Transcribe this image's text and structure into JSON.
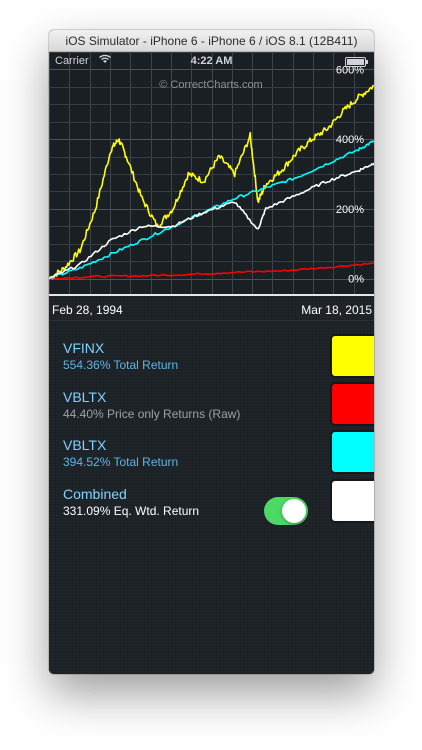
{
  "window": {
    "title": "iOS Simulator - iPhone 6 - iPhone 6 / iOS 8.1 (12B411)"
  },
  "status_bar": {
    "carrier": "Carrier",
    "wifi_icon": "wifi-icon",
    "time": "4:22 AM",
    "battery_icon": "battery-icon"
  },
  "chart": {
    "watermark": "© CorrectCharts.com",
    "start_date": "Feb 28, 1994",
    "end_date": "Mar 18, 2015"
  },
  "chart_data": {
    "type": "line",
    "x": [
      "Feb 28, 1994",
      "Mar 18, 2015"
    ],
    "yticks": [
      "0%",
      "200%",
      "400%",
      "600%"
    ],
    "ylim": [
      -50,
      650
    ],
    "grid": true,
    "series": [
      {
        "name": "VFINX",
        "color": "#ffff00",
        "values": [
          [
            0,
            0
          ],
          [
            1,
            30
          ],
          [
            2,
            80
          ],
          [
            3,
            200
          ],
          [
            4,
            370
          ],
          [
            4.5,
            400
          ],
          [
            5,
            350
          ],
          [
            6,
            230
          ],
          [
            7,
            150
          ],
          [
            8,
            200
          ],
          [
            9,
            300
          ],
          [
            10,
            280
          ],
          [
            11,
            350
          ],
          [
            12,
            300
          ],
          [
            13,
            410
          ],
          [
            13.5,
            220
          ],
          [
            14,
            270
          ],
          [
            15,
            310
          ],
          [
            16,
            360
          ],
          [
            17,
            400
          ],
          [
            18,
            430
          ],
          [
            19,
            480
          ],
          [
            20,
            520
          ],
          [
            21,
            554
          ]
        ]
      },
      {
        "name": "VBLTX",
        "color": "#ff0000",
        "values": [
          [
            0,
            0
          ],
          [
            3,
            6
          ],
          [
            6,
            8
          ],
          [
            9,
            12
          ],
          [
            12,
            18
          ],
          [
            15,
            22
          ],
          [
            18,
            32
          ],
          [
            21,
            44
          ]
        ]
      },
      {
        "name": "VBLTX",
        "color": "#00ffff",
        "values": [
          [
            0,
            0
          ],
          [
            2,
            30
          ],
          [
            4,
            70
          ],
          [
            6,
            110
          ],
          [
            8,
            150
          ],
          [
            10,
            190
          ],
          [
            12,
            230
          ],
          [
            14,
            260
          ],
          [
            16,
            290
          ],
          [
            18,
            330
          ],
          [
            20,
            370
          ],
          [
            21,
            395
          ]
        ]
      },
      {
        "name": "Combined",
        "color": "#ffffff",
        "values": [
          [
            0,
            0
          ],
          [
            2,
            40
          ],
          [
            4,
            110
          ],
          [
            6,
            150
          ],
          [
            8,
            150
          ],
          [
            10,
            190
          ],
          [
            12,
            220
          ],
          [
            13.5,
            140
          ],
          [
            14,
            200
          ],
          [
            16,
            240
          ],
          [
            18,
            280
          ],
          [
            20,
            310
          ],
          [
            21,
            331
          ]
        ]
      }
    ]
  },
  "legend": [
    {
      "name": "VFINX",
      "desc": "554.36% Total Return",
      "color": "#ffff00"
    },
    {
      "name": "VBLTX",
      "desc": "44.40% Price only Returns (Raw)",
      "color": "#ff0000"
    },
    {
      "name": "VBLTX",
      "desc": "394.52% Total Return",
      "color": "#00ffff"
    },
    {
      "name": "Combined",
      "desc": "331.09% Eq. Wtd. Return",
      "color": "#ffffff",
      "toggle_on": true
    }
  ]
}
